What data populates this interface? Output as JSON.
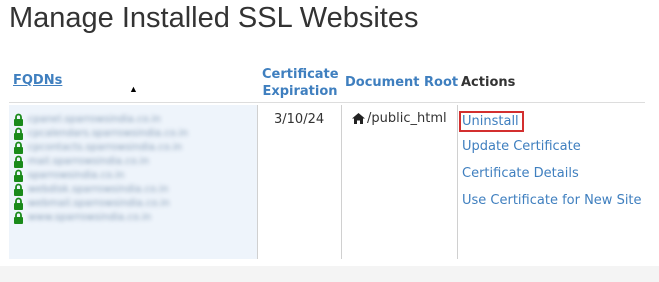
{
  "page": {
    "title": "Manage Installed SSL Websites"
  },
  "table": {
    "headers": {
      "fqdns": "FQDNs",
      "certificate_expiration_line1": "Certificate",
      "certificate_expiration_line2": "Expiration",
      "document_root": "Document Root",
      "actions": "Actions"
    },
    "sort_indicator": "▲",
    "row": {
      "domains": [
        "cpanel.sparrowsindia.co.in",
        "cpcalendars.sparrowsindia.co.in",
        "cpcontacts.sparrowsindia.co.in",
        "mail.sparrowsindia.co.in",
        "sparrowsindia.co.in",
        "webdisk.sparrowsindia.co.in",
        "webmail.sparrowsindia.co.in",
        "www.sparrowsindia.co.in"
      ],
      "expiration": "3/10/24",
      "document_root": "/public_html",
      "actions": {
        "uninstall": "Uninstall",
        "update_certificate": "Update Certificate",
        "certificate_details": "Certificate Details",
        "use_for_new_site": "Use Certificate for New Site"
      }
    }
  },
  "icons": {
    "domain": "lock-icon",
    "doc_root": "home-icon",
    "sort": "sort-ascending-icon"
  },
  "colors": {
    "link": "#3f7fbf",
    "lock": "#1a8a1a",
    "highlight": "#d32f2f",
    "fqdn_cell_bg": "#eef4fb"
  }
}
